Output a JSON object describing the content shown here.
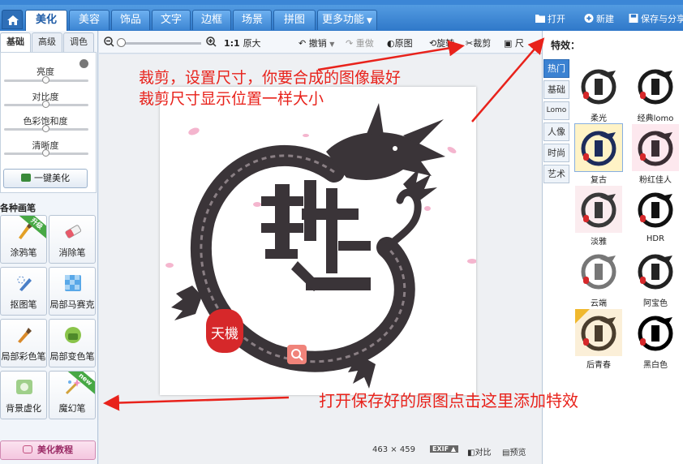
{
  "top": {
    "tabs": [
      {
        "label": "美化",
        "active": true
      },
      {
        "label": "美容"
      },
      {
        "label": "饰品"
      },
      {
        "label": "文字"
      },
      {
        "label": "边框"
      },
      {
        "label": "场景"
      },
      {
        "label": "拼图"
      },
      {
        "label": "更多功能"
      }
    ],
    "open": "打开",
    "new": "新建",
    "save_share": "保存与分享"
  },
  "left": {
    "subtabs": [
      "基础",
      "高级",
      "调色"
    ],
    "sliders": [
      {
        "label": "亮度",
        "value": 0.5
      },
      {
        "label": "对比度",
        "value": 0.5
      },
      {
        "label": "色彩饱和度",
        "value": 0.5
      },
      {
        "label": "清晰度",
        "value": 0.5
      }
    ],
    "one_key": "一键美化",
    "brush_section": "各种画笔",
    "brushes": [
      {
        "label": "涂鸦笔",
        "ribbon": "升级"
      },
      {
        "label": "消除笔"
      },
      {
        "label": "抠图笔"
      },
      {
        "label": "局部马赛克"
      },
      {
        "label": "局部彩色笔"
      },
      {
        "label": "局部变色笔"
      },
      {
        "label": "背景虚化"
      },
      {
        "label": "魔幻笔",
        "ribbon": "new"
      }
    ],
    "tutorial": "美化教程"
  },
  "toolbar": {
    "ratio": "1:1",
    "original_size": "原大",
    "undo": "撤销",
    "redo": "重做",
    "original": "原图",
    "rotate": "旋转",
    "crop": "裁剪",
    "size": "尺"
  },
  "canvas": {
    "seal_text": "天機",
    "width": "463",
    "times": "×",
    "height": "459",
    "exif": "EXIF",
    "compare": "对比",
    "preview": "预览"
  },
  "right": {
    "title": "特效：",
    "categories": [
      {
        "label": "热门",
        "active": true
      },
      {
        "label": "基础"
      },
      {
        "label": "Lomo"
      },
      {
        "label": "人像"
      },
      {
        "label": "时尚"
      },
      {
        "label": "艺术"
      }
    ],
    "effects": [
      {
        "label": "柔光",
        "bg": "#ffffff",
        "ink": "#2a2a2a"
      },
      {
        "label": "经典lomo",
        "bg": "#ffffff",
        "ink": "#1b1b1b"
      },
      {
        "label": "复古",
        "bg": "#fff3c6",
        "ink": "#1c2c5c"
      },
      {
        "label": "粉红佳人",
        "bg": "#fde8ee",
        "ink": "#3a2e33"
      },
      {
        "label": "淡雅",
        "bg": "#fbecef",
        "ink": "#393939"
      },
      {
        "label": "HDR",
        "bg": "#ffffff",
        "ink": "#111111"
      },
      {
        "label": "云端",
        "bg": "#ffffff",
        "ink": "#777777"
      },
      {
        "label": "阿宝色",
        "bg": "#ffffff",
        "ink": "#222222"
      },
      {
        "label": "后青春",
        "bg": "#fbefd8",
        "ink": "#4a3d2d",
        "badge": "#f0b82d"
      },
      {
        "label": "黑白色",
        "bg": "#ffffff",
        "ink": "#000000"
      }
    ]
  },
  "annotations": {
    "crop_line1": "裁剪，设置尺寸，你要合成的图像最好",
    "crop_line2": "裁剪尺寸显示位置一样大小",
    "effect_hint": "打开保存好的原图点击这里添加特效"
  },
  "colors": {
    "accent": "#2f78c9",
    "annotation": "#e8221b",
    "dragon": "#3a3438",
    "seal": "#d6282a"
  }
}
